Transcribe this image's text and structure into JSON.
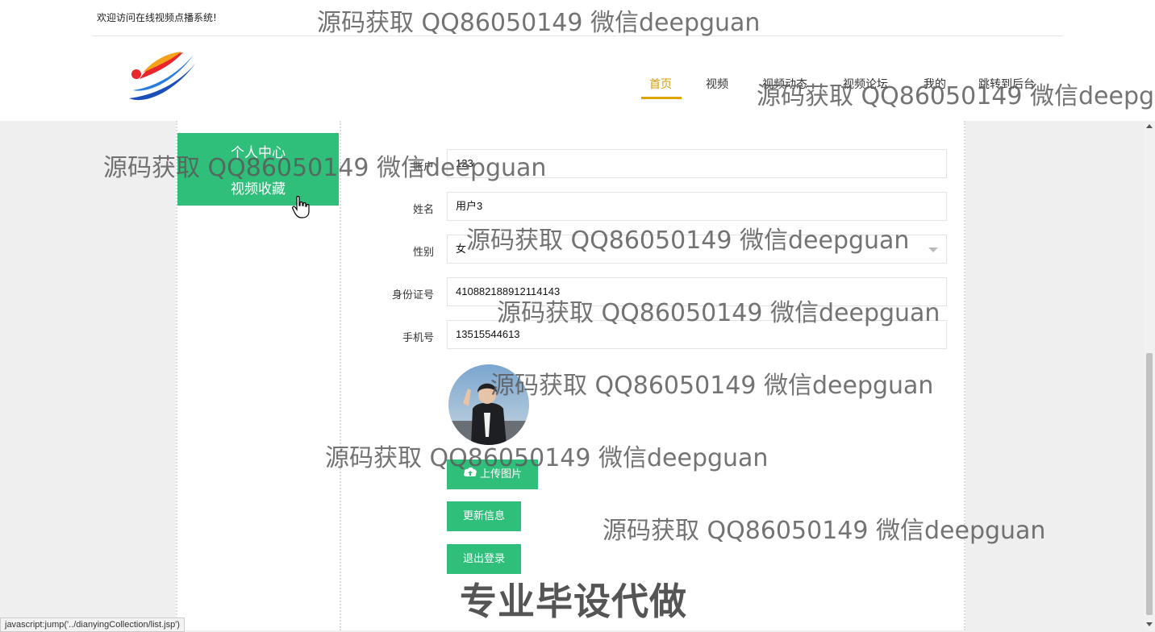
{
  "header": {
    "welcome": "欢迎访问在线视频点播系统!",
    "nav": [
      "首页",
      "视频",
      "视频动态",
      "视频论坛",
      "我的",
      "跳转到后台"
    ],
    "active_nav": "首页"
  },
  "sidebar": {
    "items": [
      "个人中心",
      "视频收藏"
    ]
  },
  "form": {
    "fields": [
      {
        "label": "账户",
        "value": "123"
      },
      {
        "label": "姓名",
        "value": "用户3"
      },
      {
        "label": "性别",
        "value": "女"
      },
      {
        "label": "身份证号",
        "value": "410882188912114143"
      },
      {
        "label": "手机号",
        "value": "13515544613"
      }
    ],
    "upload_label": "上传图片",
    "update_label": "更新信息",
    "logout_label": "退出登录"
  },
  "watermark": {
    "text": "源码获取 QQ86050149 微信deepguan",
    "big": "专业毕设代做"
  },
  "status_url": "javascript:jump('../dianyingCollection/list.jsp')",
  "colors": {
    "accent": "#2fbf7a",
    "active_nav": "#d99b00"
  }
}
